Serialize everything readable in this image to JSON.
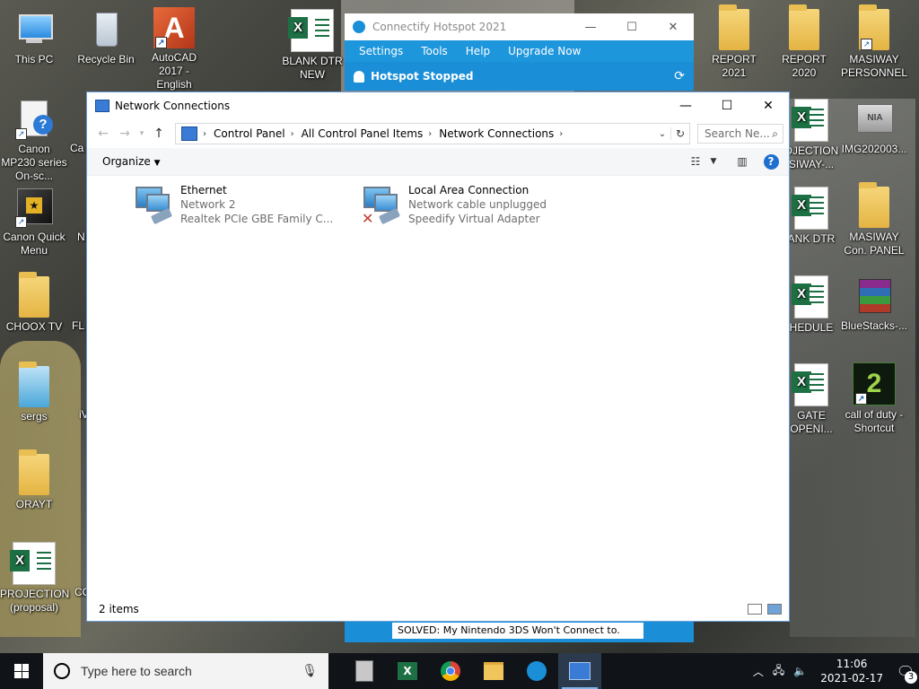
{
  "desktop": {
    "icons_left": [
      {
        "label": "This PC",
        "icon": "this-pc-icon"
      },
      {
        "label": "Recycle Bin",
        "icon": "recycle-bin-icon"
      },
      {
        "label": "AutoCAD 2017 - English",
        "icon": "autocad-icon"
      },
      {
        "label": "BLANK DTR NEW",
        "icon": "excel-file-icon"
      },
      {
        "label": "Canon MP230 series On-sc...",
        "icon": "canon-help-icon"
      },
      {
        "label": "Canon Quick Menu",
        "icon": "canon-quick-menu-icon"
      },
      {
        "label": "CHOOX TV",
        "icon": "folder-icon"
      },
      {
        "label": "sergs",
        "icon": "folder-icon"
      },
      {
        "label": "ORAYT",
        "icon": "folder-icon"
      },
      {
        "label": "PROJECTION (proposal)",
        "icon": "excel-file-icon"
      }
    ],
    "partial_left": [
      "Ca",
      "N",
      "FL",
      "iV",
      "CC"
    ],
    "icons_right": [
      {
        "label": "REPORT 2021",
        "icon": "folder-icon"
      },
      {
        "label": "REPORT 2020",
        "icon": "folder-icon"
      },
      {
        "label": "MASIWAY PERSONNEL",
        "icon": "folder-icon"
      },
      {
        "label": "OJECTION SIWAY-...",
        "icon": "excel-file-icon"
      },
      {
        "label": "IMG202003...",
        "icon": "image-file-icon"
      },
      {
        "label": "ANK DTR",
        "icon": "excel-file-icon"
      },
      {
        "label": "MASIWAY Con. PANEL",
        "icon": "folder-icon"
      },
      {
        "label": "HEDULE",
        "icon": "excel-file-icon"
      },
      {
        "label": "BlueStacks-...",
        "icon": "winrar-icon"
      },
      {
        "label": "GATE OPENI...",
        "icon": "excel-file-icon"
      },
      {
        "label": "call of duty - Shortcut",
        "icon": "call-of-duty-icon"
      }
    ]
  },
  "connectify": {
    "title": "Connectify Hotspot 2021",
    "menu": [
      "Settings",
      "Tools",
      "Help",
      "Upgrade Now"
    ],
    "status": "Hotspot Stopped",
    "banner": "SOLVED: My Nintendo 3DS Won't Connect to."
  },
  "explorer": {
    "title": "Network Connections",
    "breadcrumb": [
      "Control Panel",
      "All Control Panel Items",
      "Network Connections"
    ],
    "search_placeholder": "Search Ne...",
    "organize_label": "Organize",
    "connections": [
      {
        "name": "Ethernet",
        "network": "Network 2",
        "adapter": "Realtek PCIe GBE Family C...",
        "disconnected": false
      },
      {
        "name": "Local Area Connection",
        "network": "Network cable unplugged",
        "adapter": "Speedify Virtual Adapter",
        "disconnected": true
      }
    ],
    "item_count": "2 items"
  },
  "taskbar": {
    "search_placeholder": "Type here to search",
    "time": "11:06",
    "date": "2021-02-17",
    "notification_count": "3"
  }
}
